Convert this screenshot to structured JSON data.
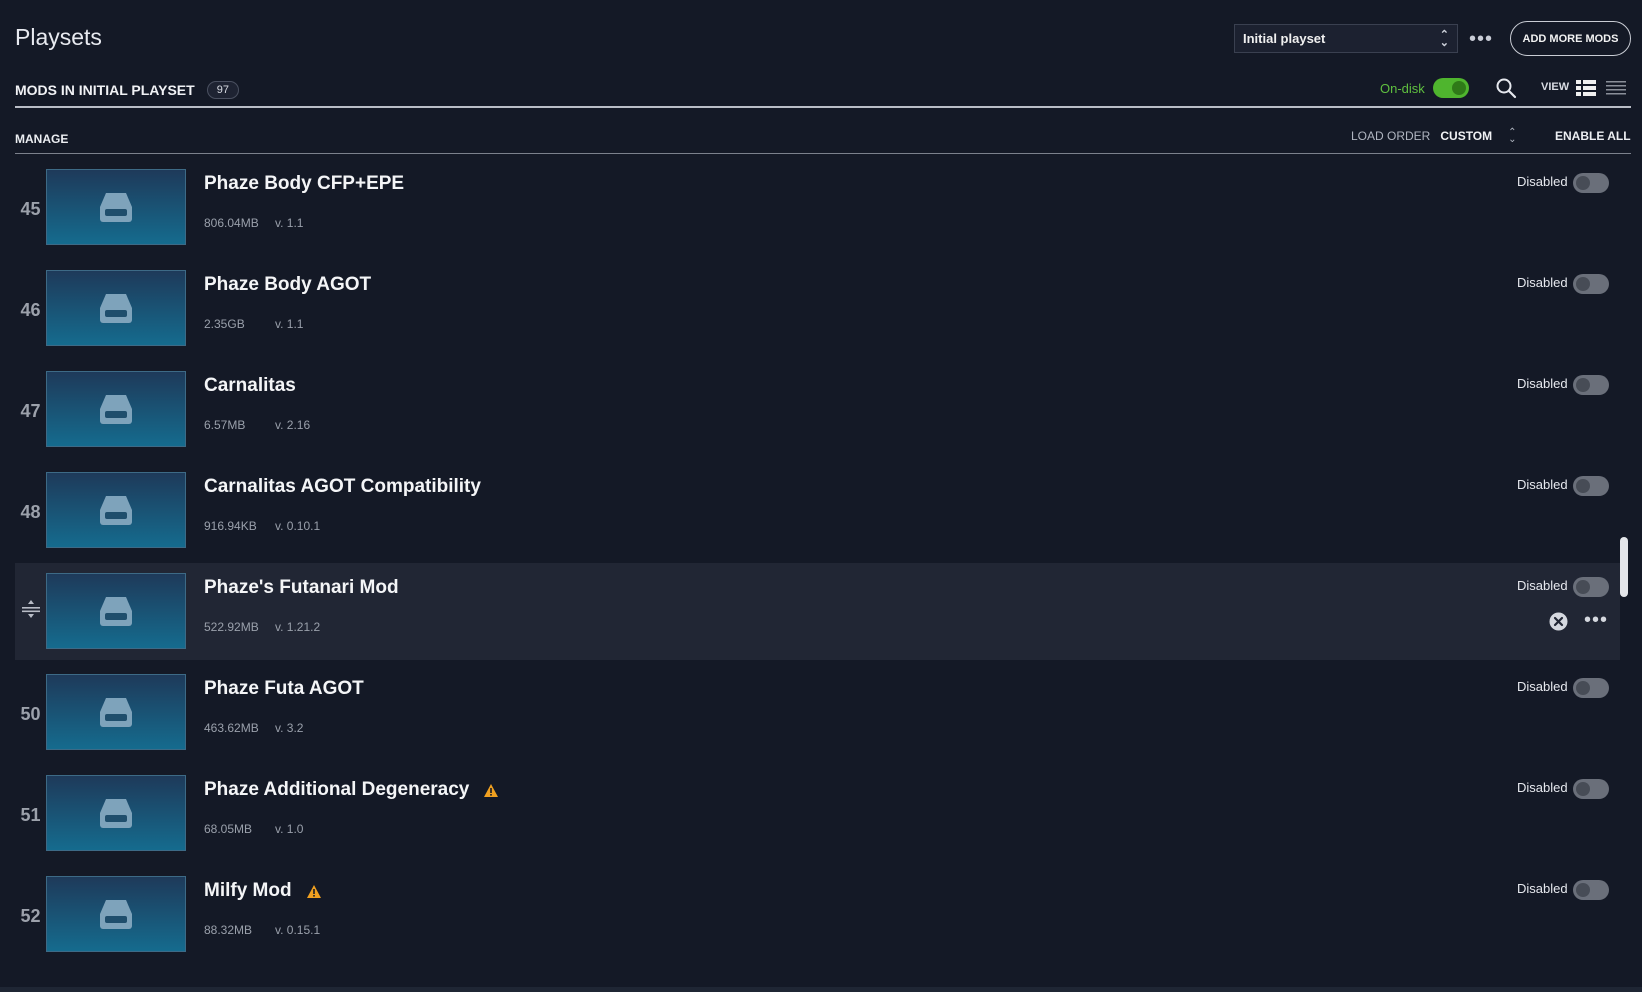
{
  "header": {
    "title": "Playsets",
    "playset_select": "Initial playset",
    "add_more_mods": "ADD MORE MODS"
  },
  "subheader": {
    "mods_label": "MODS IN INITIAL PLAYSET",
    "mods_count": "97",
    "ondisk_label": "On-disk",
    "view_label": "VIEW"
  },
  "toolbar": {
    "manage": "MANAGE",
    "load_order_label": "LOAD ORDER",
    "load_order_value": "CUSTOM",
    "enable_all": "ENABLE ALL"
  },
  "mods": [
    {
      "num": "45",
      "name": "Phaze Body CFP+EPE",
      "size": "806.04MB",
      "version": "v. 1.1",
      "status": "Disabled"
    },
    {
      "num": "46",
      "name": "Phaze Body AGOT",
      "size": "2.35GB",
      "version": "v. 1.1",
      "status": "Disabled"
    },
    {
      "num": "47",
      "name": "Carnalitas",
      "size": "6.57MB",
      "version": "v. 2.16",
      "status": "Disabled"
    },
    {
      "num": "48",
      "name": "Carnalitas AGOT Compatibility",
      "size": "916.94KB",
      "version": "v. 0.10.1",
      "status": "Disabled"
    },
    {
      "num": "",
      "name": "Phaze's Futanari Mod",
      "size": "522.92MB",
      "version": "v. 1.21.2",
      "status": "Disabled"
    },
    {
      "num": "50",
      "name": "Phaze Futa AGOT",
      "size": "463.62MB",
      "version": "v. 3.2",
      "status": "Disabled"
    },
    {
      "num": "51",
      "name": "Phaze Additional Degeneracy",
      "size": "68.05MB",
      "version": "v. 1.0",
      "status": "Disabled"
    },
    {
      "num": "52",
      "name": "Milfy Mod",
      "size": "88.32MB",
      "version": "v. 0.15.1",
      "status": "Disabled"
    }
  ],
  "colors": {
    "background": "#141926",
    "accent_green": "#4fb52e",
    "warning": "#f0a020"
  }
}
